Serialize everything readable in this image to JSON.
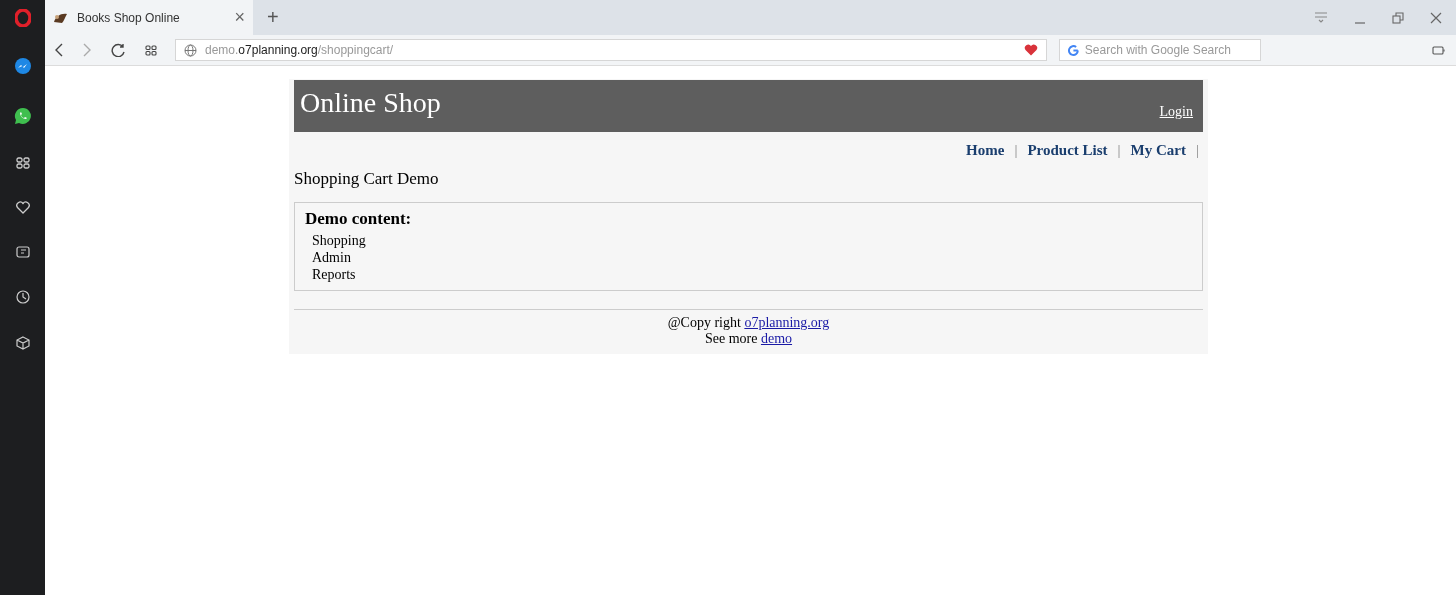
{
  "browser": {
    "tab": {
      "title": "Books Shop Online",
      "close": "×",
      "selected": true
    },
    "new_tab": "+",
    "address": {
      "segments": [
        {
          "text": "demo.",
          "emphasis": false
        },
        {
          "text": "o7planning.org",
          "emphasis": true
        },
        {
          "text": "/shoppingcart/",
          "emphasis": false
        }
      ]
    },
    "search": {
      "placeholder": "Search with Google Search"
    },
    "sidebar": [
      {
        "kind": "messenger"
      },
      {
        "kind": "whatsapp"
      },
      {
        "kind": "speeddial"
      },
      {
        "kind": "heart"
      },
      {
        "kind": "news"
      },
      {
        "kind": "history"
      },
      {
        "kind": "box"
      }
    ]
  },
  "page": {
    "header": {
      "title": "Online Shop",
      "login": "Login"
    },
    "menu": [
      {
        "label": "Home"
      },
      {
        "label": "Product List"
      },
      {
        "label": "My Cart"
      }
    ],
    "separator": "|",
    "page_title": "Shopping Cart Demo",
    "demo": {
      "heading": "Demo content:",
      "items": [
        "Shopping",
        "Admin",
        "Reports"
      ]
    },
    "footer": {
      "copyright": "@Copy right ",
      "copyright_link": "o7planning.org",
      "more": "See more ",
      "more_link": "demo"
    }
  }
}
